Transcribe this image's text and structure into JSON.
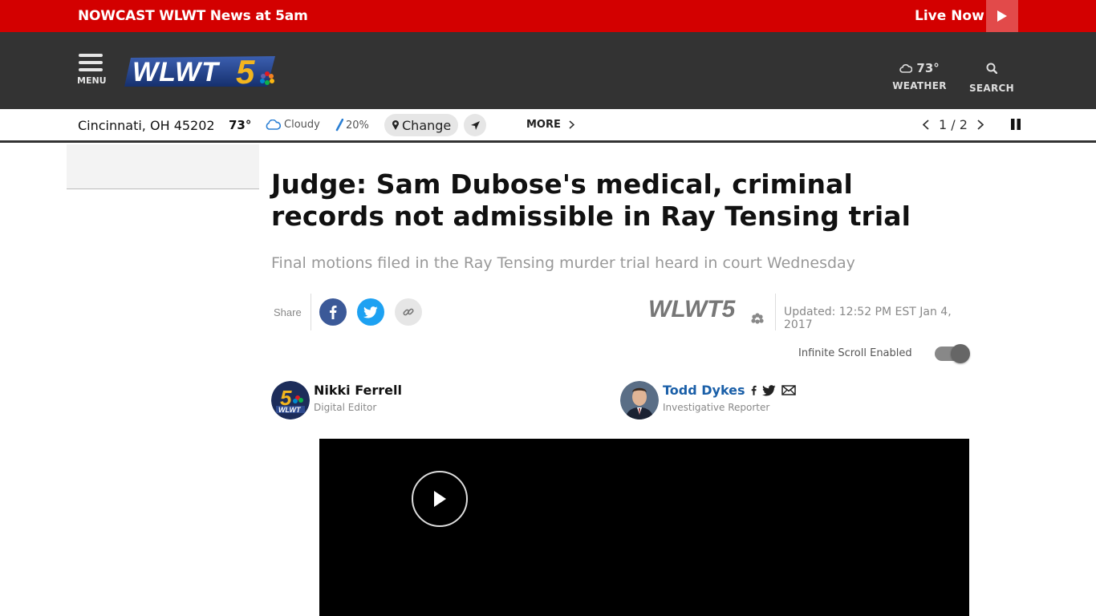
{
  "topbar": {
    "nowcast_prefix": "NOWCAST",
    "nowcast_title": "WLWT News at 5am",
    "live_label": "Live Now",
    "color": "#d30000"
  },
  "header": {
    "menu_label": "MENU",
    "logo_text": "WLWT5",
    "weather_temp": "73°",
    "weather_label": "WEATHER",
    "search_label": "SEARCH"
  },
  "weather_strip": {
    "location": "Cincinnati, OH 45202",
    "temp": "73°",
    "condition": "Cloudy",
    "precip": "20%",
    "change_label": "Change",
    "more_label": "MORE",
    "pager": "1 / 2"
  },
  "article": {
    "headline": "Judge: Sam Dubose's medical, criminal records not admissible in Ray Tensing trial",
    "subhead": "Final motions filed in the Ray Tensing murder trial heard in court Wednesday",
    "share_label": "Share",
    "source_logo": "WLWT5",
    "updated": "Updated: 12:52 PM EST Jan 4, 2017",
    "infinite_scroll_label": "Infinite Scroll Enabled",
    "authors": [
      {
        "name": "Nikki Ferrell",
        "role": "Digital Editor"
      },
      {
        "name": "Todd Dykes",
        "role": "Investigative Reporter"
      }
    ]
  }
}
